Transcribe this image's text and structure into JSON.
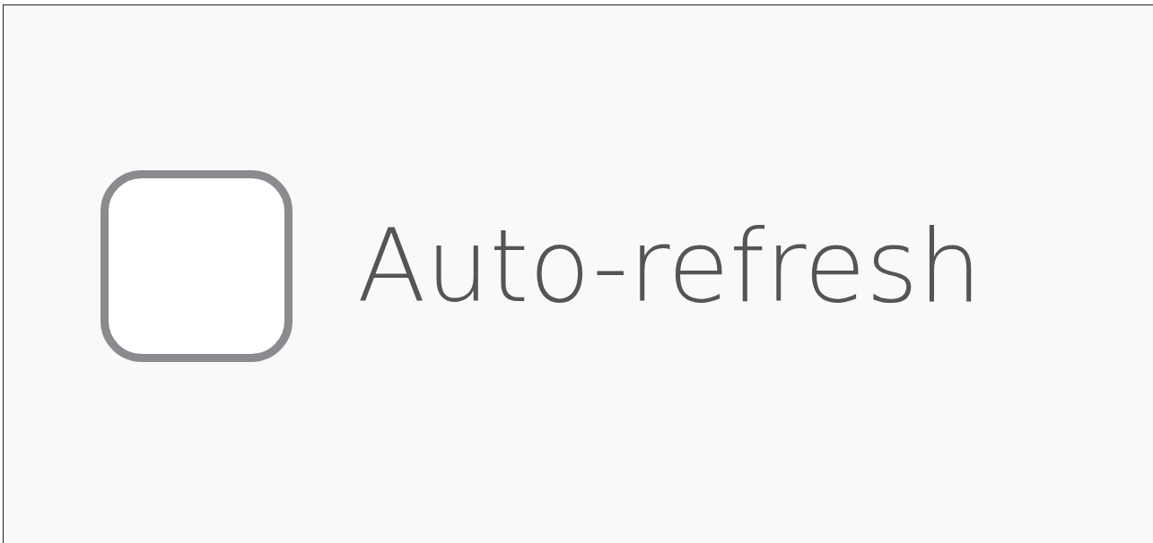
{
  "checkbox": {
    "label": "Auto-refresh",
    "checked": false
  }
}
